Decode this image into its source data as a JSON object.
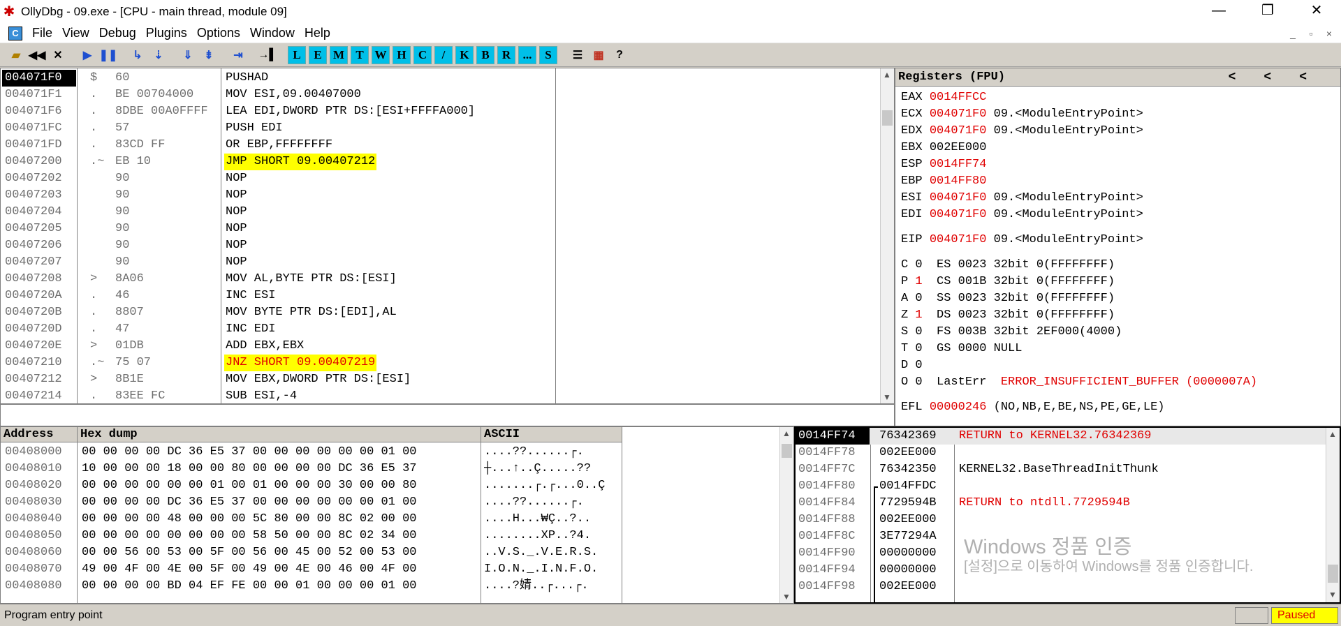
{
  "window": {
    "title": "OllyDbg - 09.exe - [CPU - main thread, module 09]",
    "buttons": {
      "minimize": "—",
      "restore": "❐",
      "close": "✕"
    }
  },
  "menu": {
    "mdi_icon": "C",
    "items": [
      "File",
      "View",
      "Debug",
      "Plugins",
      "Options",
      "Window",
      "Help"
    ],
    "mdi_buttons": [
      "_",
      "▫",
      "×"
    ]
  },
  "toolbar": {
    "icons": [
      "open-icon",
      "rewind-icon",
      "close-icon",
      "run-icon",
      "pause-icon",
      "step-into-icon",
      "step-over-icon",
      "trace-into-icon",
      "trace-over-icon",
      "execute-till-return-icon",
      "go-to-icon"
    ],
    "letters": [
      "L",
      "E",
      "M",
      "T",
      "W",
      "H",
      "C",
      "/",
      "K",
      "B",
      "R",
      "...",
      "S"
    ],
    "extra": [
      "list-icon",
      "colors-icon",
      "help-icon"
    ]
  },
  "cpu": {
    "columns": [
      "",
      "",
      "",
      ""
    ],
    "rows": [
      {
        "addr": "004071F0",
        "mark": "$",
        "hex": "60",
        "asm": "PUSHAD",
        "comment": "",
        "selected": true
      },
      {
        "addr": "004071F1",
        "mark": ".",
        "hex": "BE 00704000",
        "asm": "MOV ESI,09.00407000",
        "comment": ""
      },
      {
        "addr": "004071F6",
        "mark": ".",
        "hex": "8DBE 00A0FFFF",
        "asm": "LEA EDI,DWORD PTR DS:[ESI+FFFFA000]",
        "comment": ""
      },
      {
        "addr": "004071FC",
        "mark": ".",
        "hex": "57",
        "asm": "PUSH EDI",
        "comment": ""
      },
      {
        "addr": "004071FD",
        "mark": ".",
        "hex": "83CD FF",
        "asm": "OR EBP,FFFFFFFF",
        "comment": ""
      },
      {
        "addr": "00407200",
        "mark": ".~",
        "hex": "EB 10",
        "asm": "JMP SHORT 09.00407212",
        "comment": "",
        "jump": true
      },
      {
        "addr": "00407202",
        "mark": "",
        "hex": "90",
        "asm": "NOP",
        "comment": ""
      },
      {
        "addr": "00407203",
        "mark": "",
        "hex": "90",
        "asm": "NOP",
        "comment": ""
      },
      {
        "addr": "00407204",
        "mark": "",
        "hex": "90",
        "asm": "NOP",
        "comment": ""
      },
      {
        "addr": "00407205",
        "mark": "",
        "hex": "90",
        "asm": "NOP",
        "comment": ""
      },
      {
        "addr": "00407206",
        "mark": "",
        "hex": "90",
        "asm": "NOP",
        "comment": ""
      },
      {
        "addr": "00407207",
        "mark": "",
        "hex": "90",
        "asm": "NOP",
        "comment": ""
      },
      {
        "addr": "00407208",
        "mark": ">",
        "hex": "8A06",
        "asm": "MOV AL,BYTE PTR DS:[ESI]",
        "comment": ""
      },
      {
        "addr": "0040720A",
        "mark": ".",
        "hex": "46",
        "asm": "INC ESI",
        "comment": ""
      },
      {
        "addr": "0040720B",
        "mark": ".",
        "hex": "8807",
        "asm": "MOV BYTE PTR DS:[EDI],AL",
        "comment": ""
      },
      {
        "addr": "0040720D",
        "mark": ".",
        "hex": "47",
        "asm": "INC EDI",
        "comment": ""
      },
      {
        "addr": "0040720E",
        "mark": ">",
        "hex": "01DB",
        "asm": "ADD EBX,EBX",
        "comment": ""
      },
      {
        "addr": "00407210",
        "mark": ".~",
        "hex": "75 07",
        "asm": "JNZ SHORT 09.00407219",
        "comment": "",
        "jump": true,
        "red": true
      },
      {
        "addr": "00407212",
        "mark": ">",
        "hex": "8B1E",
        "asm": "MOV EBX,DWORD PTR DS:[ESI]",
        "comment": ""
      },
      {
        "addr": "00407214",
        "mark": ".",
        "hex": "83EE FC",
        "asm": "SUB ESI,-4",
        "comment": ""
      }
    ],
    "info_line": ""
  },
  "registers": {
    "title": "Registers (FPU)",
    "arrows": [
      "<",
      "<",
      "<"
    ],
    "general": [
      {
        "name": "EAX",
        "value": "0014FFCC",
        "comment": "",
        "changed": true
      },
      {
        "name": "ECX",
        "value": "004071F0",
        "comment": "09.<ModuleEntryPoint>",
        "changed": true
      },
      {
        "name": "EDX",
        "value": "004071F0",
        "comment": "09.<ModuleEntryPoint>",
        "changed": true
      },
      {
        "name": "EBX",
        "value": "002EE000",
        "comment": "",
        "changed": false
      },
      {
        "name": "ESP",
        "value": "0014FF74",
        "comment": "",
        "changed": true
      },
      {
        "name": "EBP",
        "value": "0014FF80",
        "comment": "",
        "changed": true
      },
      {
        "name": "ESI",
        "value": "004071F0",
        "comment": "09.<ModuleEntryPoint>",
        "changed": true
      },
      {
        "name": "EDI",
        "value": "004071F0",
        "comment": "09.<ModuleEntryPoint>",
        "changed": true
      }
    ],
    "eip": {
      "name": "EIP",
      "value": "004071F0",
      "comment": "09.<ModuleEntryPoint>"
    },
    "flags": [
      {
        "flag": "C",
        "val": "0",
        "seg": "ES",
        "sel": "0023",
        "desc": "32bit 0(FFFFFFFF)",
        "red": false
      },
      {
        "flag": "P",
        "val": "1",
        "seg": "CS",
        "sel": "001B",
        "desc": "32bit 0(FFFFFFFF)",
        "red": true
      },
      {
        "flag": "A",
        "val": "0",
        "seg": "SS",
        "sel": "0023",
        "desc": "32bit 0(FFFFFFFF)",
        "red": false
      },
      {
        "flag": "Z",
        "val": "1",
        "seg": "DS",
        "sel": "0023",
        "desc": "32bit 0(FFFFFFFF)",
        "red": true
      },
      {
        "flag": "S",
        "val": "0",
        "seg": "FS",
        "sel": "003B",
        "desc": "32bit 2EF000(4000)",
        "red": false
      },
      {
        "flag": "T",
        "val": "0",
        "seg": "GS",
        "sel": "0000",
        "desc": "NULL",
        "red": false
      },
      {
        "flag": "D",
        "val": "0",
        "seg": "",
        "sel": "",
        "desc": "",
        "red": false
      },
      {
        "flag": "O",
        "val": "0",
        "seg": "LastErr",
        "sel": "",
        "desc": "ERROR_INSUFFICIENT_BUFFER (0000007A)",
        "red": false,
        "descRed": true
      }
    ],
    "efl": {
      "name": "EFL",
      "value": "00000246",
      "comment": "(NO,NB,E,BE,NS,PE,GE,LE)"
    }
  },
  "dump": {
    "headers": [
      "Address",
      "Hex dump",
      "ASCII"
    ],
    "rows": [
      {
        "addr": "00408000",
        "hex": "00 00 00 00 DC 36 E5 37 00 00 00 00 00 00 01 00",
        "ascii": "....??......┌."
      },
      {
        "addr": "00408010",
        "hex": "10 00 00 00 18 00 00 80 00 00 00 00 DC 36 E5 37",
        "ascii": "┼...↑..Ç.....??"
      },
      {
        "addr": "00408020",
        "hex": "00 00 00 00 00 00 01 00 01 00 00 00 30 00 00 80",
        "ascii": ".......┌.┌...0..Ç"
      },
      {
        "addr": "00408030",
        "hex": "00 00 00 00 DC 36 E5 37 00 00 00 00 00 00 01 00",
        "ascii": "....??......┌."
      },
      {
        "addr": "00408040",
        "hex": "00 00 00 00 48 00 00 00 5C 80 00 00 8C 02 00 00",
        "ascii": "....H...₩Ç..?.."
      },
      {
        "addr": "00408050",
        "hex": "00 00 00 00 00 00 00 00 58 50 00 00 8C 02 34 00",
        "ascii": "........XP..?4."
      },
      {
        "addr": "00408060",
        "hex": "00 00 56 00 53 00 5F 00 56 00 45 00 52 00 53 00",
        "ascii": "..V.S._.V.E.R.S."
      },
      {
        "addr": "00408070",
        "hex": "49 00 4F 00 4E 00 5F 00 49 00 4E 00 46 00 4F 00",
        "ascii": "I.O.N._.I.N.F.O."
      },
      {
        "addr": "00408080",
        "hex": "00 00 00 00 BD 04 EF FE 00 00 01 00 00 00 01 00",
        "ascii": "....?婧..┌...┌."
      }
    ]
  },
  "stack": {
    "rows": [
      {
        "addr": "0014FF74",
        "value": "76342369",
        "comment": "RETURN to KERNEL32.76342369",
        "red": true,
        "selected": true
      },
      {
        "addr": "0014FF78",
        "value": "002EE000",
        "comment": ""
      },
      {
        "addr": "0014FF7C",
        "value": "76342350",
        "comment": "KERNEL32.BaseThreadInitThunk"
      },
      {
        "addr": "0014FF80",
        "value": "0014FFDC",
        "comment": "",
        "frame": true
      },
      {
        "addr": "0014FF84",
        "value": "7729594B",
        "comment": "RETURN to ntdll.7729594B",
        "red": true
      },
      {
        "addr": "0014FF88",
        "value": "002EE000",
        "comment": ""
      },
      {
        "addr": "0014FF8C",
        "value": "3E77294A",
        "comment": ""
      },
      {
        "addr": "0014FF90",
        "value": "00000000",
        "comment": ""
      },
      {
        "addr": "0014FF94",
        "value": "00000000",
        "comment": ""
      },
      {
        "addr": "0014FF98",
        "value": "002EE000",
        "comment": ""
      }
    ]
  },
  "watermark": {
    "title": "Windows 정품 인증",
    "text": "[설정]으로 이동하여 Windows를 정품 인증합니다."
  },
  "status": {
    "message": "Program entry point",
    "state": "Paused"
  },
  "colors": {
    "highlight": "#ffff00",
    "changed": "#e00000",
    "background": "#d4d0c8"
  }
}
